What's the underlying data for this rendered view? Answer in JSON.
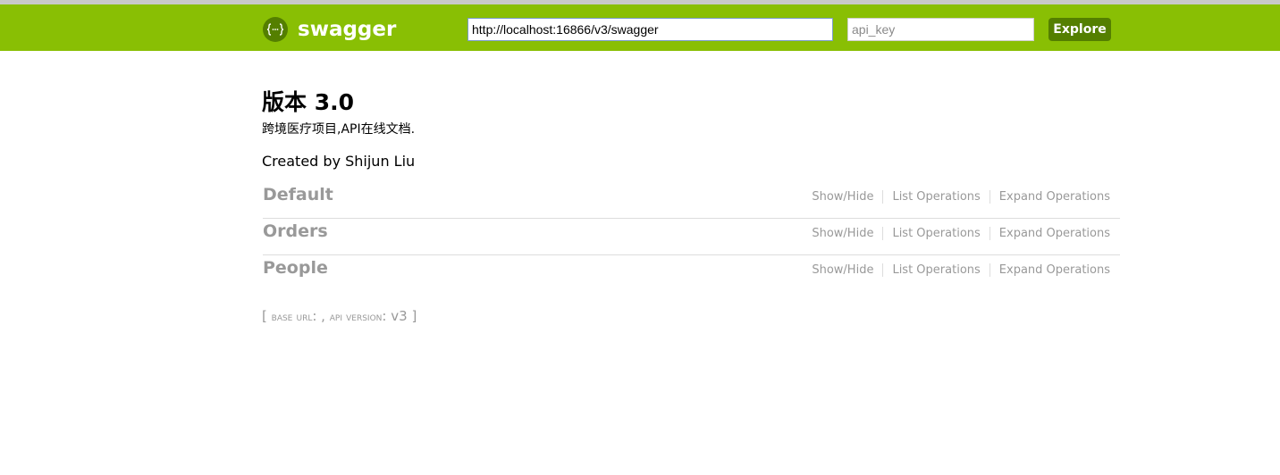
{
  "header": {
    "logo_icon": "braces-icon",
    "logo_icon_glyph": "{···}",
    "logo_text": "swagger",
    "url_value": "http://localhost:16866/v3/swagger",
    "api_key_placeholder": "api_key",
    "explore_label": "Explore",
    "colors": {
      "bar": "#89bf04",
      "accent": "#547f00"
    }
  },
  "info": {
    "title": "版本 3.0",
    "description": "跨境医疗项目,API在线文档.",
    "created_by": "Created by Shijun Liu"
  },
  "resources": [
    {
      "name": "Default",
      "show_hide": "Show/Hide",
      "list_ops": "List Operations",
      "expand_ops": "Expand Operations"
    },
    {
      "name": "Orders",
      "show_hide": "Show/Hide",
      "list_ops": "List Operations",
      "expand_ops": "Expand Operations"
    },
    {
      "name": "People",
      "show_hide": "Show/Hide",
      "list_ops": "List Operations",
      "expand_ops": "Expand Operations"
    }
  ],
  "footer": {
    "open_bracket": "[",
    "base_url_label": "base url",
    "base_url_sep": ": ,",
    "api_version_label": "api version",
    "api_version_sep": ":",
    "api_version_value": "v3",
    "close_bracket": "]"
  }
}
